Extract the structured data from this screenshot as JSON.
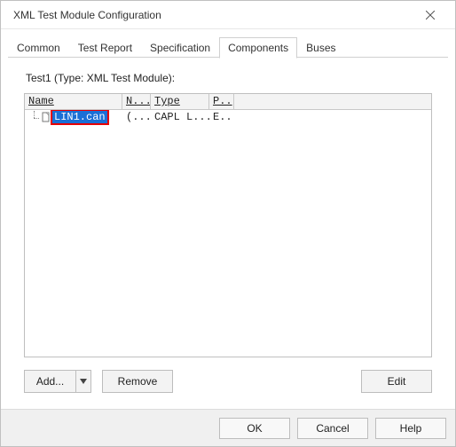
{
  "window": {
    "title": "XML Test Module Configuration"
  },
  "tabs": {
    "common": "Common",
    "test_report": "Test Report",
    "specification": "Specification",
    "components": "Components",
    "buses": "Buses",
    "active": "components"
  },
  "module_label": "Test1 (Type: XML Test Module):",
  "columns": {
    "name": "Name",
    "n": "N...",
    "type": "Type",
    "p": "P.."
  },
  "rows": [
    {
      "filename": "LIN1.can",
      "n": "(...",
      "type": "CAPL L...",
      "p": "E.."
    }
  ],
  "actions": {
    "add": "Add...",
    "remove": "Remove",
    "edit": "Edit"
  },
  "bottom": {
    "ok": "OK",
    "cancel": "Cancel",
    "help": "Help"
  },
  "icons": {
    "close": "close-icon",
    "chevron_down": "chevron-down-icon",
    "file": "file-icon"
  }
}
